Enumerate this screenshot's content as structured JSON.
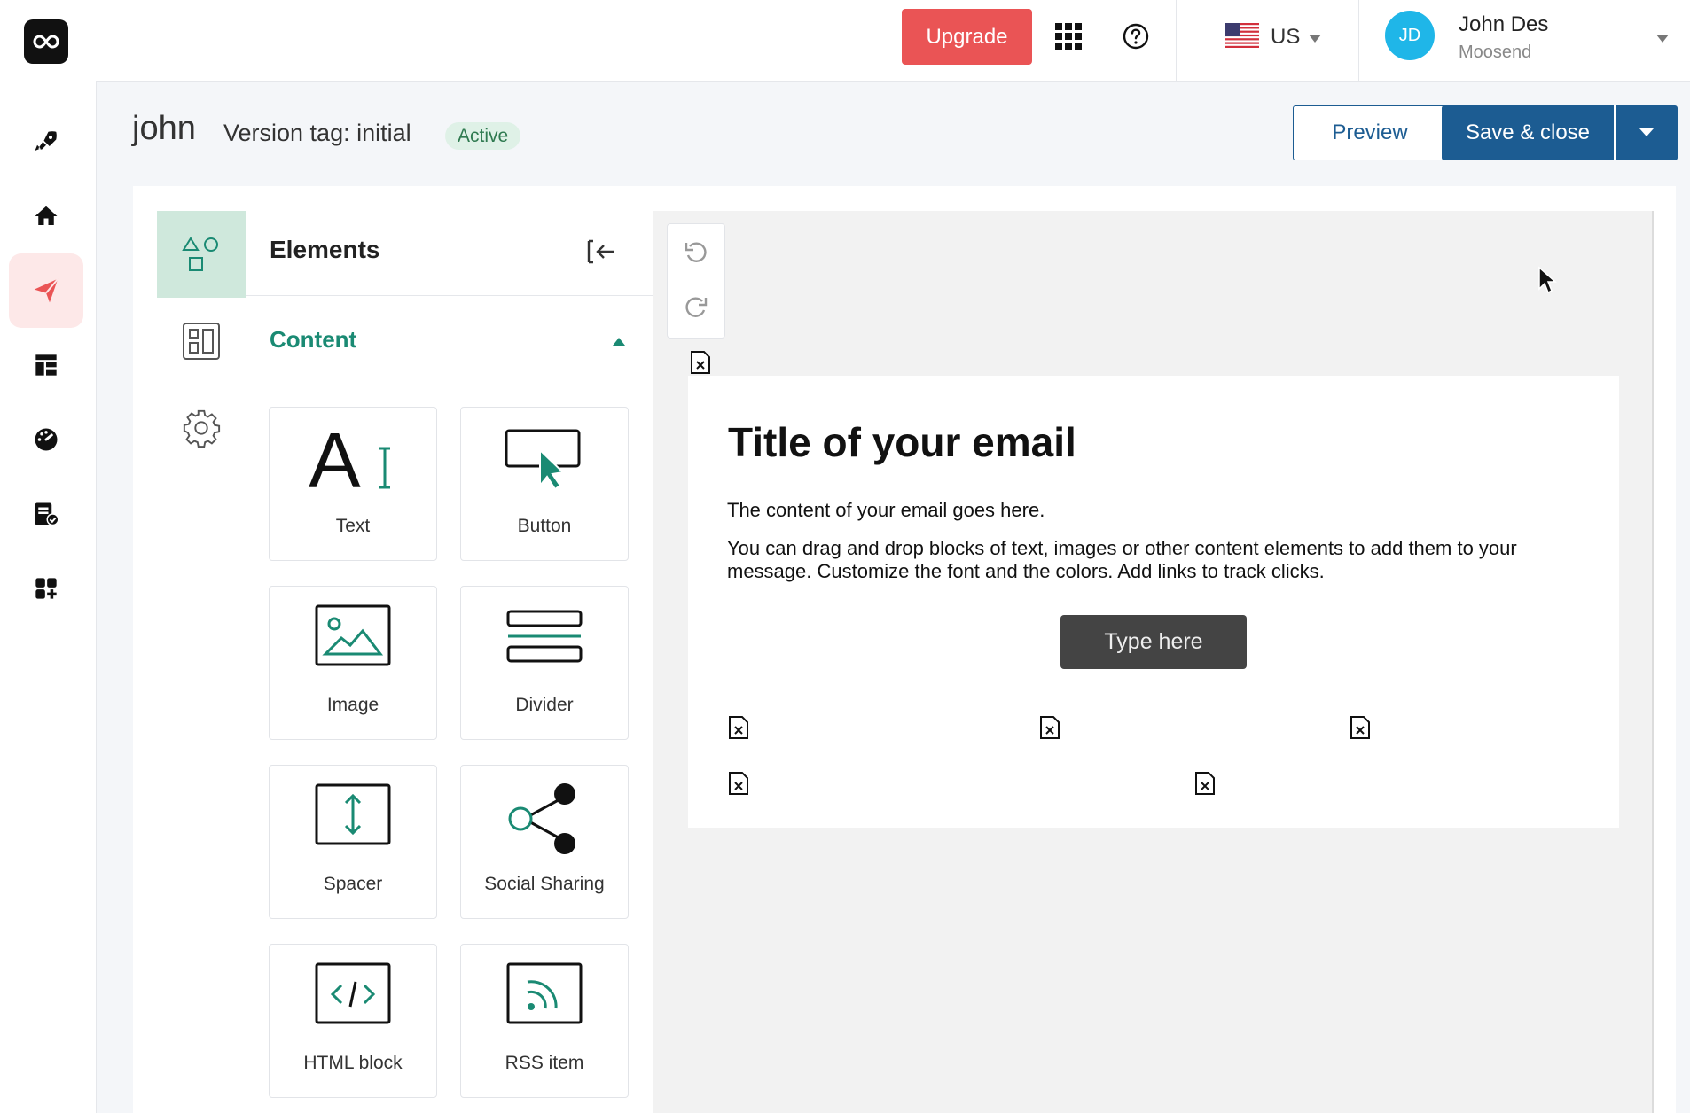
{
  "header": {
    "upgrade_label": "Upgrade",
    "locale_label": "US",
    "user": {
      "initials": "JD",
      "name": "John Des",
      "org": "Moosend"
    }
  },
  "titlebar": {
    "campaign_name": "john",
    "version_tag": "Version tag: initial",
    "status_badge": "Active",
    "preview_label": "Preview",
    "save_label": "Save & close"
  },
  "elements_panel": {
    "title": "Elements",
    "section_label": "Content",
    "items": [
      {
        "label": "Text",
        "icon": "text-icon"
      },
      {
        "label": "Button",
        "icon": "button-icon"
      },
      {
        "label": "Image",
        "icon": "image-icon"
      },
      {
        "label": "Divider",
        "icon": "divider-icon"
      },
      {
        "label": "Spacer",
        "icon": "spacer-icon"
      },
      {
        "label": "Social Sharing",
        "icon": "share-icon"
      },
      {
        "label": "HTML block",
        "icon": "code-icon"
      },
      {
        "label": "RSS item",
        "icon": "rss-icon"
      }
    ]
  },
  "email": {
    "title": "Title of your email",
    "paragraph1": "The content of your email goes here.",
    "paragraph2": "You can drag and drop blocks of text, images or other content elements to add them to your message. Customize the font and the colors. Add links to track clicks.",
    "button_label": "Type here"
  },
  "colors": {
    "accent_red": "#ea5455",
    "primary_blue": "#1c5c92",
    "accent_green": "#1a8a73",
    "avatar_blue": "#1fb6e8"
  }
}
